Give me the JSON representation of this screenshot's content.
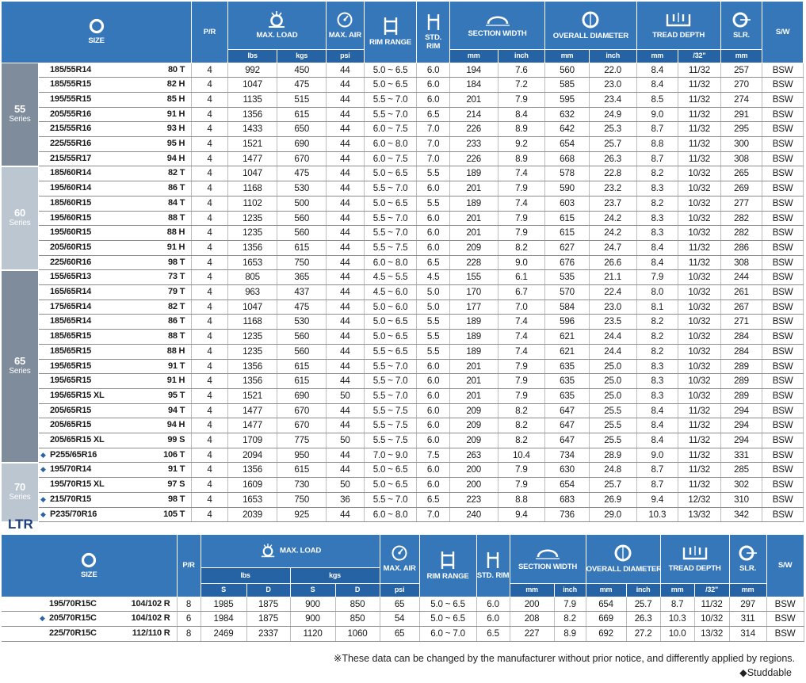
{
  "headers": {
    "size": "SIZE",
    "pr": "P/R",
    "max_load": "MAX. LOAD",
    "max_air": "MAX. AIR",
    "rim_range": "RIM RANGE",
    "std_rim": "STD. RIM",
    "section_width": "SECTION WIDTH",
    "overall_diameter": "OVERALL DIAMETER",
    "tread_depth": "TREAD DEPTH",
    "slr": "SLR.",
    "sw": "S/W",
    "lbs": "lbs",
    "kgs": "kgs",
    "psi": "psi",
    "mm": "mm",
    "inch": "inch",
    "n32": "/32\"",
    "s": "S",
    "d": "D"
  },
  "series": [
    {
      "num": "55",
      "label": "Series",
      "rows": [
        {
          "star": false,
          "size": "185/55R14",
          "idx": "80 T",
          "pr": "4",
          "lbs": "992",
          "kgs": "450",
          "psi": "44",
          "rim": "5.0 ~ 6.5",
          "std": "6.0",
          "sw_mm": "194",
          "sw_in": "7.6",
          "od_mm": "560",
          "od_in": "22.0",
          "td_mm": "8.4",
          "td_32": "11/32",
          "slr": "257",
          "wall": "BSW"
        },
        {
          "star": false,
          "size": "185/55R15",
          "idx": "82 H",
          "pr": "4",
          "lbs": "1047",
          "kgs": "475",
          "psi": "44",
          "rim": "5.0 ~ 6.5",
          "std": "6.0",
          "sw_mm": "184",
          "sw_in": "7.2",
          "od_mm": "585",
          "od_in": "23.0",
          "td_mm": "8.4",
          "td_32": "11/32",
          "slr": "270",
          "wall": "BSW"
        },
        {
          "star": false,
          "size": "195/55R15",
          "idx": "85 H",
          "pr": "4",
          "lbs": "1135",
          "kgs": "515",
          "psi": "44",
          "rim": "5.5 ~ 7.0",
          "std": "6.0",
          "sw_mm": "201",
          "sw_in": "7.9",
          "od_mm": "595",
          "od_in": "23.4",
          "td_mm": "8.5",
          "td_32": "11/32",
          "slr": "274",
          "wall": "BSW"
        },
        {
          "star": false,
          "size": "205/55R16",
          "idx": "91 H",
          "pr": "4",
          "lbs": "1356",
          "kgs": "615",
          "psi": "44",
          "rim": "5.5 ~ 7.0",
          "std": "6.5",
          "sw_mm": "214",
          "sw_in": "8.4",
          "od_mm": "632",
          "od_in": "24.9",
          "td_mm": "9.0",
          "td_32": "11/32",
          "slr": "291",
          "wall": "BSW"
        },
        {
          "star": false,
          "size": "215/55R16",
          "idx": "93 H",
          "pr": "4",
          "lbs": "1433",
          "kgs": "650",
          "psi": "44",
          "rim": "6.0 ~ 7.5",
          "std": "7.0",
          "sw_mm": "226",
          "sw_in": "8.9",
          "od_mm": "642",
          "od_in": "25.3",
          "td_mm": "8.7",
          "td_32": "11/32",
          "slr": "295",
          "wall": "BSW"
        },
        {
          "star": false,
          "size": "225/55R16",
          "idx": "95 H",
          "pr": "4",
          "lbs": "1521",
          "kgs": "690",
          "psi": "44",
          "rim": "6.0 ~ 8.0",
          "std": "7.0",
          "sw_mm": "233",
          "sw_in": "9.2",
          "od_mm": "654",
          "od_in": "25.7",
          "td_mm": "8.8",
          "td_32": "11/32",
          "slr": "300",
          "wall": "BSW"
        },
        {
          "star": false,
          "size": "215/55R17",
          "idx": "94 H",
          "pr": "4",
          "lbs": "1477",
          "kgs": "670",
          "psi": "44",
          "rim": "6.0 ~ 7.5",
          "std": "7.0",
          "sw_mm": "226",
          "sw_in": "8.9",
          "od_mm": "668",
          "od_in": "26.3",
          "td_mm": "8.7",
          "td_32": "11/32",
          "slr": "308",
          "wall": "BSW"
        }
      ]
    },
    {
      "num": "60",
      "label": "Series",
      "rows": [
        {
          "star": false,
          "size": "185/60R14",
          "idx": "82 T",
          "pr": "4",
          "lbs": "1047",
          "kgs": "475",
          "psi": "44",
          "rim": "5.0 ~ 6.5",
          "std": "5.5",
          "sw_mm": "189",
          "sw_in": "7.4",
          "od_mm": "578",
          "od_in": "22.8",
          "td_mm": "8.2",
          "td_32": "10/32",
          "slr": "265",
          "wall": "BSW"
        },
        {
          "star": false,
          "size": "195/60R14",
          "idx": "86 T",
          "pr": "4",
          "lbs": "1168",
          "kgs": "530",
          "psi": "44",
          "rim": "5.5 ~ 7.0",
          "std": "6.0",
          "sw_mm": "201",
          "sw_in": "7.9",
          "od_mm": "590",
          "od_in": "23.2",
          "td_mm": "8.3",
          "td_32": "10/32",
          "slr": "269",
          "wall": "BSW"
        },
        {
          "star": false,
          "size": "185/60R15",
          "idx": "84 T",
          "pr": "4",
          "lbs": "1102",
          "kgs": "500",
          "psi": "44",
          "rim": "5.0 ~ 6.5",
          "std": "5.5",
          "sw_mm": "189",
          "sw_in": "7.4",
          "od_mm": "603",
          "od_in": "23.7",
          "td_mm": "8.2",
          "td_32": "10/32",
          "slr": "277",
          "wall": "BSW"
        },
        {
          "star": false,
          "size": "195/60R15",
          "idx": "88 T",
          "pr": "4",
          "lbs": "1235",
          "kgs": "560",
          "psi": "44",
          "rim": "5.5 ~ 7.0",
          "std": "6.0",
          "sw_mm": "201",
          "sw_in": "7.9",
          "od_mm": "615",
          "od_in": "24.2",
          "td_mm": "8.3",
          "td_32": "10/32",
          "slr": "282",
          "wall": "BSW"
        },
        {
          "star": false,
          "size": "195/60R15",
          "idx": "88 H",
          "pr": "4",
          "lbs": "1235",
          "kgs": "560",
          "psi": "44",
          "rim": "5.5 ~ 7.0",
          "std": "6.0",
          "sw_mm": "201",
          "sw_in": "7.9",
          "od_mm": "615",
          "od_in": "24.2",
          "td_mm": "8.3",
          "td_32": "10/32",
          "slr": "282",
          "wall": "BSW"
        },
        {
          "star": false,
          "size": "205/60R15",
          "idx": "91 H",
          "pr": "4",
          "lbs": "1356",
          "kgs": "615",
          "psi": "44",
          "rim": "5.5 ~ 7.5",
          "std": "6.0",
          "sw_mm": "209",
          "sw_in": "8.2",
          "od_mm": "627",
          "od_in": "24.7",
          "td_mm": "8.4",
          "td_32": "11/32",
          "slr": "286",
          "wall": "BSW"
        },
        {
          "star": false,
          "size": "225/60R16",
          "idx": "98 T",
          "pr": "4",
          "lbs": "1653",
          "kgs": "750",
          "psi": "44",
          "rim": "6.0 ~ 8.0",
          "std": "6.5",
          "sw_mm": "228",
          "sw_in": "9.0",
          "od_mm": "676",
          "od_in": "26.6",
          "td_mm": "8.4",
          "td_32": "11/32",
          "slr": "308",
          "wall": "BSW"
        }
      ]
    },
    {
      "num": "65",
      "label": "Series",
      "rows": [
        {
          "star": false,
          "size": "155/65R13",
          "idx": "73 T",
          "pr": "4",
          "lbs": "805",
          "kgs": "365",
          "psi": "44",
          "rim": "4.5 ~ 5.5",
          "std": "4.5",
          "sw_mm": "155",
          "sw_in": "6.1",
          "od_mm": "535",
          "od_in": "21.1",
          "td_mm": "7.9",
          "td_32": "10/32",
          "slr": "244",
          "wall": "BSW"
        },
        {
          "star": false,
          "size": "165/65R14",
          "idx": "79 T",
          "pr": "4",
          "lbs": "963",
          "kgs": "437",
          "psi": "44",
          "rim": "4.5 ~ 6.0",
          "std": "5.0",
          "sw_mm": "170",
          "sw_in": "6.7",
          "od_mm": "570",
          "od_in": "22.4",
          "td_mm": "8.0",
          "td_32": "10/32",
          "slr": "261",
          "wall": "BSW"
        },
        {
          "star": false,
          "size": "175/65R14",
          "idx": "82 T",
          "pr": "4",
          "lbs": "1047",
          "kgs": "475",
          "psi": "44",
          "rim": "5.0 ~ 6.0",
          "std": "5.0",
          "sw_mm": "177",
          "sw_in": "7.0",
          "od_mm": "584",
          "od_in": "23.0",
          "td_mm": "8.1",
          "td_32": "10/32",
          "slr": "267",
          "wall": "BSW"
        },
        {
          "star": false,
          "size": "185/65R14",
          "idx": "86 T",
          "pr": "4",
          "lbs": "1168",
          "kgs": "530",
          "psi": "44",
          "rim": "5.0 ~ 6.5",
          "std": "5.5",
          "sw_mm": "189",
          "sw_in": "7.4",
          "od_mm": "596",
          "od_in": "23.5",
          "td_mm": "8.2",
          "td_32": "10/32",
          "slr": "271",
          "wall": "BSW"
        },
        {
          "star": false,
          "size": "185/65R15",
          "idx": "88 T",
          "pr": "4",
          "lbs": "1235",
          "kgs": "560",
          "psi": "44",
          "rim": "5.0 ~ 6.5",
          "std": "5.5",
          "sw_mm": "189",
          "sw_in": "7.4",
          "od_mm": "621",
          "od_in": "24.4",
          "td_mm": "8.2",
          "td_32": "10/32",
          "slr": "284",
          "wall": "BSW"
        },
        {
          "star": false,
          "size": "185/65R15",
          "idx": "88 H",
          "pr": "4",
          "lbs": "1235",
          "kgs": "560",
          "psi": "44",
          "rim": "5.5 ~ 6.5",
          "std": "5.5",
          "sw_mm": "189",
          "sw_in": "7.4",
          "od_mm": "621",
          "od_in": "24.4",
          "td_mm": "8.2",
          "td_32": "10/32",
          "slr": "284",
          "wall": "BSW"
        },
        {
          "star": false,
          "size": "195/65R15",
          "idx": "91 T",
          "pr": "4",
          "lbs": "1356",
          "kgs": "615",
          "psi": "44",
          "rim": "5.5 ~ 7.0",
          "std": "6.0",
          "sw_mm": "201",
          "sw_in": "7.9",
          "od_mm": "635",
          "od_in": "25.0",
          "td_mm": "8.3",
          "td_32": "10/32",
          "slr": "289",
          "wall": "BSW"
        },
        {
          "star": false,
          "size": "195/65R15",
          "idx": "91 H",
          "pr": "4",
          "lbs": "1356",
          "kgs": "615",
          "psi": "44",
          "rim": "5.5 ~ 7.0",
          "std": "6.0",
          "sw_mm": "201",
          "sw_in": "7.9",
          "od_mm": "635",
          "od_in": "25.0",
          "td_mm": "8.3",
          "td_32": "10/32",
          "slr": "289",
          "wall": "BSW"
        },
        {
          "star": false,
          "size": "195/65R15 XL",
          "idx": "95 T",
          "pr": "4",
          "lbs": "1521",
          "kgs": "690",
          "psi": "50",
          "rim": "5.5 ~ 7.0",
          "std": "6.0",
          "sw_mm": "201",
          "sw_in": "7.9",
          "od_mm": "635",
          "od_in": "25.0",
          "td_mm": "8.3",
          "td_32": "10/32",
          "slr": "289",
          "wall": "BSW"
        },
        {
          "star": false,
          "size": "205/65R15",
          "idx": "94 T",
          "pr": "4",
          "lbs": "1477",
          "kgs": "670",
          "psi": "44",
          "rim": "5.5 ~ 7.5",
          "std": "6.0",
          "sw_mm": "209",
          "sw_in": "8.2",
          "od_mm": "647",
          "od_in": "25.5",
          "td_mm": "8.4",
          "td_32": "11/32",
          "slr": "294",
          "wall": "BSW"
        },
        {
          "star": false,
          "size": "205/65R15",
          "idx": "94 H",
          "pr": "4",
          "lbs": "1477",
          "kgs": "670",
          "psi": "44",
          "rim": "5.5 ~ 7.5",
          "std": "6.0",
          "sw_mm": "209",
          "sw_in": "8.2",
          "od_mm": "647",
          "od_in": "25.5",
          "td_mm": "8.4",
          "td_32": "11/32",
          "slr": "294",
          "wall": "BSW"
        },
        {
          "star": false,
          "size": "205/65R15 XL",
          "idx": "99 S",
          "pr": "4",
          "lbs": "1709",
          "kgs": "775",
          "psi": "50",
          "rim": "5.5 ~ 7.5",
          "std": "6.0",
          "sw_mm": "209",
          "sw_in": "8.2",
          "od_mm": "647",
          "od_in": "25.5",
          "td_mm": "8.4",
          "td_32": "11/32",
          "slr": "294",
          "wall": "BSW"
        },
        {
          "star": true,
          "size": "P255/65R16",
          "idx": "106 T",
          "pr": "4",
          "lbs": "2094",
          "kgs": "950",
          "psi": "44",
          "rim": "7.0 ~ 9.0",
          "std": "7.5",
          "sw_mm": "263",
          "sw_in": "10.4",
          "od_mm": "734",
          "od_in": "28.9",
          "td_mm": "9.0",
          "td_32": "11/32",
          "slr": "331",
          "wall": "BSW"
        }
      ]
    },
    {
      "num": "70",
      "label": "Series",
      "rows": [
        {
          "star": true,
          "size": "195/70R14",
          "idx": "91 T",
          "pr": "4",
          "lbs": "1356",
          "kgs": "615",
          "psi": "44",
          "rim": "5.0 ~ 6.5",
          "std": "6.0",
          "sw_mm": "200",
          "sw_in": "7.9",
          "od_mm": "630",
          "od_in": "24.8",
          "td_mm": "8.7",
          "td_32": "11/32",
          "slr": "285",
          "wall": "BSW"
        },
        {
          "star": false,
          "size": "195/70R15 XL",
          "idx": "97 S",
          "pr": "4",
          "lbs": "1609",
          "kgs": "730",
          "psi": "50",
          "rim": "5.0 ~ 6.5",
          "std": "6.0",
          "sw_mm": "200",
          "sw_in": "7.9",
          "od_mm": "654",
          "od_in": "25.7",
          "td_mm": "8.7",
          "td_32": "11/32",
          "slr": "302",
          "wall": "BSW"
        },
        {
          "star": true,
          "size": "215/70R15",
          "idx": "98 T",
          "pr": "4",
          "lbs": "1653",
          "kgs": "750",
          "psi": "36",
          "rim": "5.5 ~ 7.0",
          "std": "6.5",
          "sw_mm": "223",
          "sw_in": "8.8",
          "od_mm": "683",
          "od_in": "26.9",
          "td_mm": "9.4",
          "td_32": "12/32",
          "slr": "310",
          "wall": "BSW"
        },
        {
          "star": true,
          "size": "P235/70R16",
          "idx": "105 T",
          "pr": "4",
          "lbs": "2039",
          "kgs": "925",
          "psi": "44",
          "rim": "6.0 ~ 8.0",
          "std": "7.0",
          "sw_mm": "240",
          "sw_in": "9.4",
          "od_mm": "736",
          "od_in": "29.0",
          "td_mm": "10.3",
          "td_32": "13/32",
          "slr": "342",
          "wall": "BSW"
        }
      ]
    }
  ],
  "ltr": {
    "title": "LTR",
    "rows": [
      {
        "star": false,
        "size": "195/70R15C",
        "idx": "104/102 R",
        "pr": "8",
        "lbs_s": "1985",
        "lbs_d": "1875",
        "kgs_s": "900",
        "kgs_d": "850",
        "psi": "65",
        "rim": "5.0 ~ 6.5",
        "std": "6.0",
        "sw_mm": "200",
        "sw_in": "7.9",
        "od_mm": "654",
        "od_in": "25.7",
        "td_mm": "8.7",
        "td_32": "11/32",
        "slr": "297",
        "wall": "BSW"
      },
      {
        "star": true,
        "size": "205/70R15C",
        "idx": "104/102 R",
        "pr": "6",
        "lbs_s": "1984",
        "lbs_d": "1875",
        "kgs_s": "900",
        "kgs_d": "850",
        "psi": "54",
        "rim": "5.0 ~ 6.5",
        "std": "6.0",
        "sw_mm": "208",
        "sw_in": "8.2",
        "od_mm": "669",
        "od_in": "26.3",
        "td_mm": "10.3",
        "td_32": "10/32",
        "slr": "311",
        "wall": "BSW"
      },
      {
        "star": false,
        "size": "225/70R15C",
        "idx": "112/110 R",
        "pr": "8",
        "lbs_s": "2469",
        "lbs_d": "2337",
        "kgs_s": "1120",
        "kgs_d": "1060",
        "psi": "65",
        "rim": "6.0 ~ 7.0",
        "std": "6.5",
        "sw_mm": "227",
        "sw_in": "8.9",
        "od_mm": "692",
        "od_in": "27.2",
        "td_mm": "10.0",
        "td_32": "13/32",
        "slr": "314",
        "wall": "BSW"
      }
    ]
  },
  "footnote": "※These data can be changed by the manufacturer without prior notice, and differently applied by regions.",
  "studdable": "◆Studdable",
  "colors": {
    "header": "#3577b8",
    "header_sub": "#2663a4",
    "series_light": "#bcc6d1",
    "series_dark": "#7f8c9c",
    "star": "#2c63a6",
    "title": "#1c3f82"
  }
}
